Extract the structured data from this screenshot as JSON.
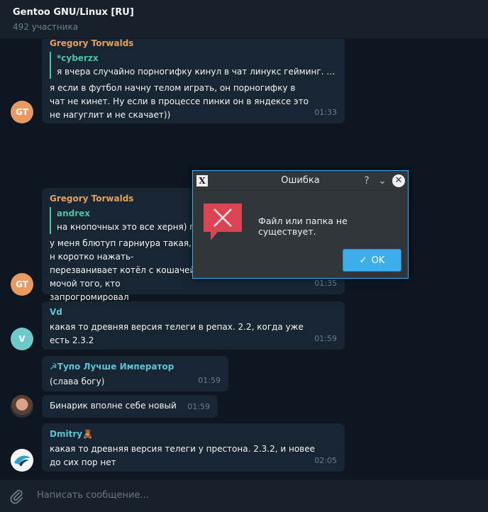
{
  "header": {
    "title": "Gentoo GNU/Linux [RU]",
    "subtitle": "492 участника"
  },
  "messages": [
    {
      "author": "Gregory Torwalds",
      "reply_name": "*cyberzx",
      "reply_text": "я вчера случайно порногифку кинул в чат линукс гейминг. е...",
      "text": "я если в футбол начну телом играть, он порногифку в чат не кинет. Ну если в процессе пинки он в яндексе это не нагуглит и не скачает))",
      "time": "01:33",
      "avatar_initials": "GT"
    },
    {
      "author": "Gregory Torwalds",
      "reply_name": "andrex",
      "reply_text": "на кнопочных это все херня) пр",
      "text": "у меня блютуп гарниура такая, н коротко нажать-перезванивает котёл с кошачей мочой того, кто запрогромировал",
      "time": "01:35",
      "avatar_initials": "GT"
    },
    {
      "author": "Vd",
      "text": "какая то древняя версия телеги в репах. 2.2, когда уже есть 2.3.2",
      "time": "01:59",
      "avatar_initials": "V"
    },
    {
      "author": "☭Тупо Лучше Император",
      "text": "(слава богу)",
      "time": "01:59"
    },
    {
      "text": "Бинарик вполне себе новый",
      "time": "01:59"
    },
    {
      "author": "Dmitry🧸",
      "text": "какая то древняя версия телеги у престона. 2.3.2, и новее до сих пор нет",
      "time": "02:05"
    }
  ],
  "input": {
    "placeholder": "Написать сообщение..."
  },
  "dialog": {
    "title": "Ошибка",
    "message": "Файл или папка  не существует.",
    "ok_label": "OK",
    "help_glyph": "?",
    "min_glyph": "⌄",
    "close_glyph": "✕",
    "ok_glyph": "✓",
    "app_glyph": "X"
  },
  "colors": {
    "accent": "#3daee9",
    "bubble": "#182533",
    "background": "#0e1621",
    "author_orange": "#e3a15f",
    "author_cyan": "#5fc3d4",
    "error_red": "#da4453"
  }
}
